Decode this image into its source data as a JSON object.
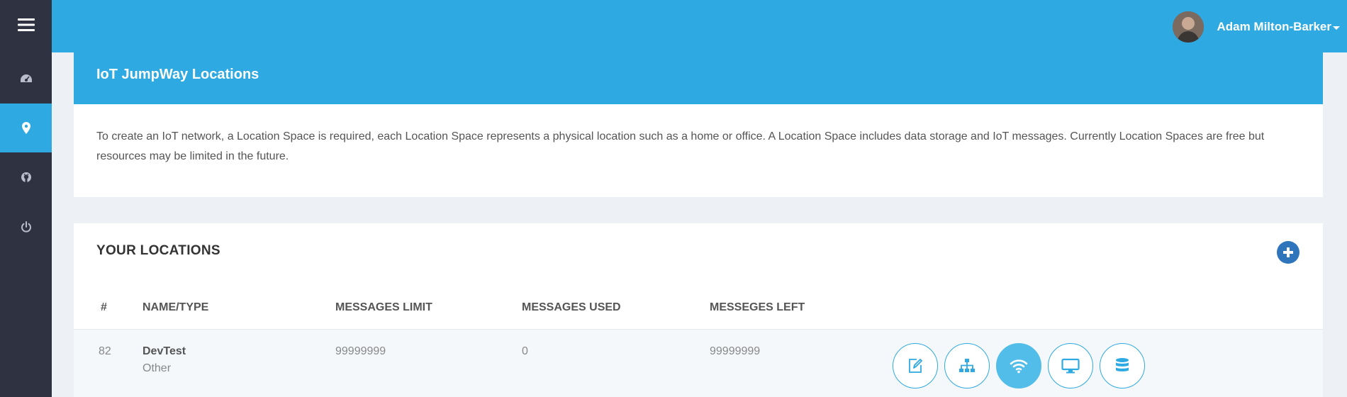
{
  "colors": {
    "accent": "#2fa9e1",
    "sidebar": "#2f3241",
    "add_button": "#2f75bb"
  },
  "sidebar": {
    "items": [
      {
        "icon": "menu-icon",
        "active": false
      },
      {
        "icon": "dashboard-icon",
        "active": false
      },
      {
        "icon": "location-pin-icon",
        "active": true
      },
      {
        "icon": "github-icon",
        "active": false
      },
      {
        "icon": "power-icon",
        "active": false
      }
    ]
  },
  "header": {
    "user_name": "Adam Milton-Barker"
  },
  "intro": {
    "title": "IoT JumpWay Locations",
    "description": "To create an IoT network, a Location Space is required, each Location Space represents a physical location such as a home or office. A Location Space includes data storage and IoT messages. Currently Location Spaces are free but resources may be limited in the future."
  },
  "locations": {
    "title": "YOUR LOCATIONS",
    "columns": [
      "#",
      "NAME/TYPE",
      "MESSAGES LIMIT",
      "MESSAGES USED",
      "MESSEGES LEFT"
    ],
    "rows": [
      {
        "id": "82",
        "name": "DevTest",
        "type": "Other",
        "limit": "99999999",
        "used": "0",
        "left": "99999999"
      }
    ],
    "actions": [
      "edit-icon",
      "sitemap-icon",
      "wifi-icon",
      "desktop-icon",
      "database-icon"
    ]
  }
}
